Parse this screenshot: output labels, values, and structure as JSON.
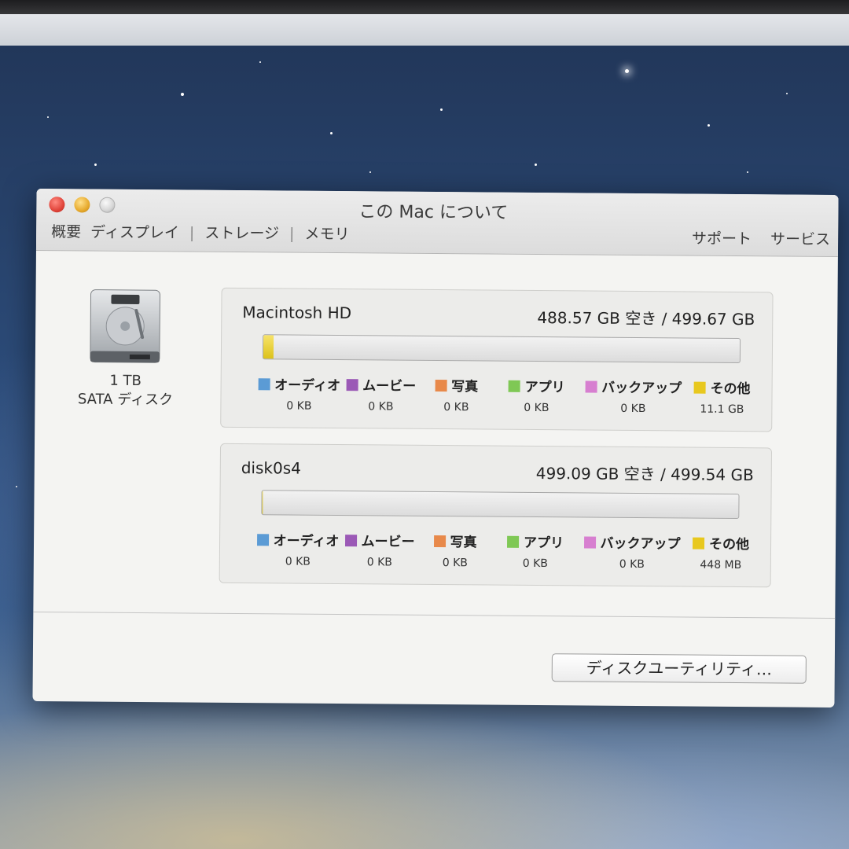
{
  "window": {
    "title": "この Mac について",
    "tabs": [
      "概要",
      "ディスプレイ",
      "ストレージ",
      "メモリ"
    ],
    "tab_separator": "|",
    "right_links": [
      "サポート",
      "サービス"
    ]
  },
  "drive": {
    "icon": "hard-drive-icon",
    "capacity": "1 TB",
    "type": "SATA ディスク"
  },
  "legend_colors": {
    "audio": "#5b9bd5",
    "movies": "#9b59b6",
    "photos": "#e8894a",
    "apps": "#7fc855",
    "backups": "#d77fd0",
    "other": "#e8c81e"
  },
  "volumes": [
    {
      "name": "Macintosh HD",
      "free_label": "488.57 GB 空き / 499.67 GB",
      "used_fraction": 0.022,
      "categories": [
        {
          "label": "オーディオ",
          "value": "0 KB"
        },
        {
          "label": "ムービー",
          "value": "0 KB"
        },
        {
          "label": "写真",
          "value": "0 KB"
        },
        {
          "label": "アプリ",
          "value": "0 KB"
        },
        {
          "label": "バックアップ",
          "value": "0 KB"
        },
        {
          "label": "その他",
          "value": "11.1 GB"
        }
      ]
    },
    {
      "name": "disk0s4",
      "free_label": "499.09 GB 空き / 499.54 GB",
      "used_fraction": 0.001,
      "categories": [
        {
          "label": "オーディオ",
          "value": "0 KB"
        },
        {
          "label": "ムービー",
          "value": "0 KB"
        },
        {
          "label": "写真",
          "value": "0 KB"
        },
        {
          "label": "アプリ",
          "value": "0 KB"
        },
        {
          "label": "バックアップ",
          "value": "0 KB"
        },
        {
          "label": "その他",
          "value": "448 MB"
        }
      ]
    }
  ],
  "disk_utility_button": "ディスクユーティリティ…"
}
